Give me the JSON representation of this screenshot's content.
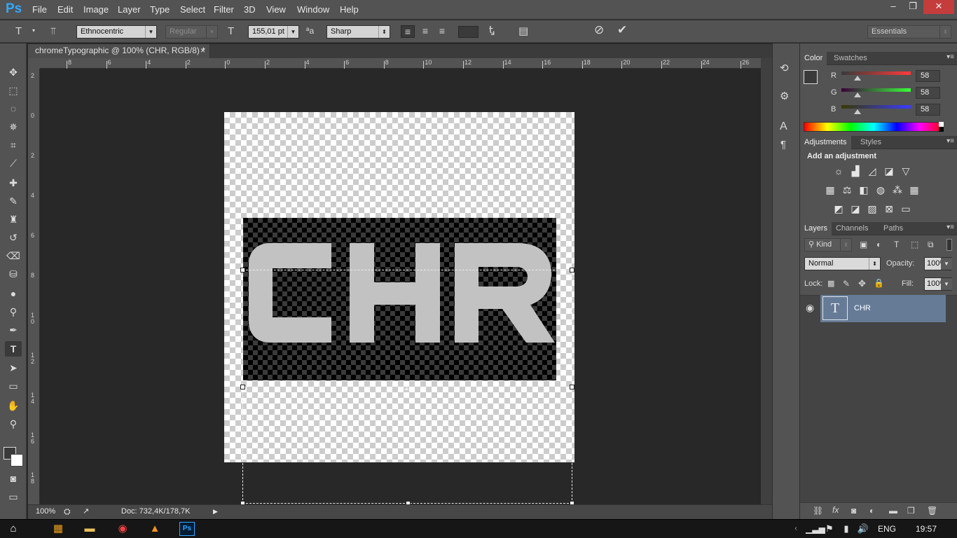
{
  "app": {
    "logo": "Ps"
  },
  "menu": [
    "File",
    "Edit",
    "Image",
    "Layer",
    "Type",
    "Select",
    "Filter",
    "3D",
    "View",
    "Window",
    "Help"
  ],
  "window_controls": {
    "minimize": "–",
    "restore": "❐",
    "close": "✕"
  },
  "options": {
    "font_family": "Ethnocentric",
    "font_style": "Regular",
    "font_size": "155,01 pt",
    "antialias_icon": "ªa",
    "antialias": "Sharp",
    "workspace": "Essentials"
  },
  "document": {
    "tab_title": "chromeTypographic @ 100% (CHR, RGB/8) *",
    "close_icon": "×",
    "canvas_text": "CHR",
    "zoom": "100%",
    "doc_size": "Doc: 732,4K/178,7K"
  },
  "rulers": {
    "h": [
      "8",
      "6",
      "4",
      "2",
      "0",
      "2",
      "4",
      "6",
      "8",
      "10",
      "12",
      "14",
      "16",
      "18",
      "20",
      "22",
      "24",
      "26"
    ],
    "v": [
      "2",
      "0",
      "2",
      "4",
      "6",
      "8",
      "1\n0",
      "1\n2",
      "1\n4",
      "1\n6",
      "1\n8"
    ]
  },
  "color_panel": {
    "tabs": [
      "Color",
      "Swatches"
    ],
    "r_label": "R",
    "g_label": "G",
    "b_label": "B",
    "r": "58",
    "g": "58",
    "b": "58",
    "r_level": 0.23,
    "g_level": 0.23,
    "b_level": 0.23
  },
  "adjustments_panel": {
    "tabs": [
      "Adjustments",
      "Styles"
    ],
    "heading": "Add an adjustment"
  },
  "layers_panel": {
    "tabs": [
      "Layers",
      "Channels",
      "Paths"
    ],
    "filter": "Kind",
    "blend_mode": "Normal",
    "opacity_label": "Opacity:",
    "opacity": "100%",
    "lock_label": "Lock:",
    "fill_label": "Fill:",
    "fill": "100%",
    "layer_thumb": "T",
    "layer_name": "CHR"
  },
  "taskbar": {
    "language": "ENG",
    "time": "19:57"
  },
  "colors": {
    "accent": "#31a8ff",
    "layer_selected": "#667b96",
    "text_fill": "#c2c2c2"
  }
}
